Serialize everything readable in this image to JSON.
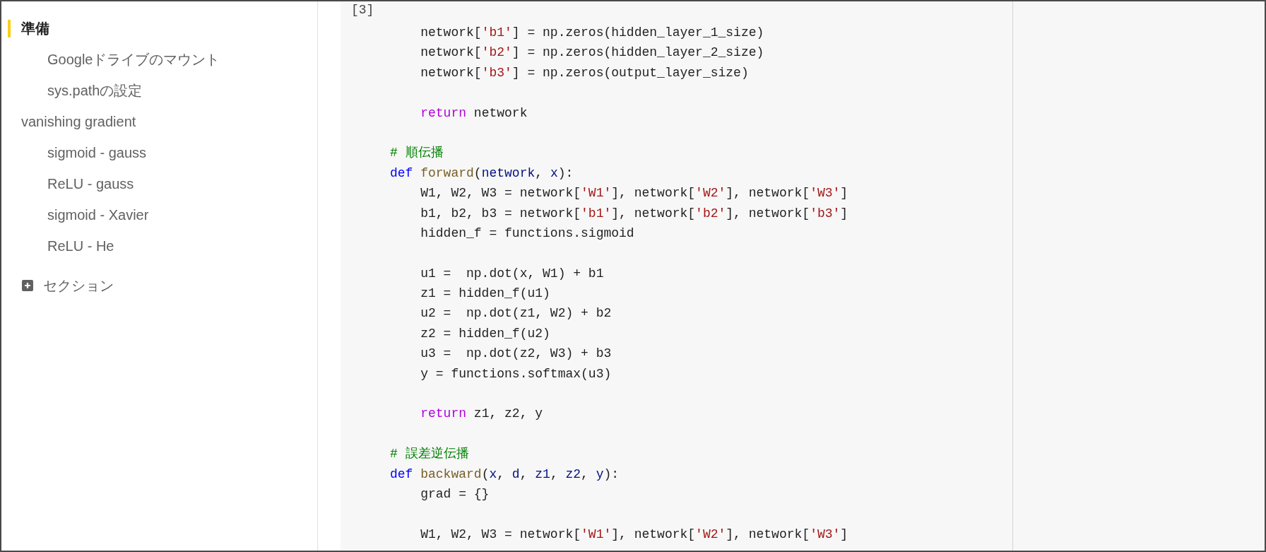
{
  "sidebar": {
    "toc": [
      {
        "label": "準備",
        "selected": true,
        "children": [
          {
            "label": "Googleドライブのマウント",
            "selected": false
          },
          {
            "label": "sys.pathの設定",
            "selected": false
          }
        ]
      },
      {
        "label": "vanishing gradient",
        "selected": false,
        "children": [
          {
            "label": "sigmoid - gauss",
            "selected": false
          },
          {
            "label": "ReLU - gauss",
            "selected": false
          },
          {
            "label": "sigmoid - Xavier",
            "selected": false
          },
          {
            "label": "ReLU - He",
            "selected": false
          }
        ]
      }
    ],
    "add_section": {
      "label": "セクション"
    }
  },
  "code_cell": {
    "execution_count": "[3]",
    "lines": [
      {
        "kind": "code",
        "tokens": [
          {
            "kind": "plain",
            "text": "    network["
          },
          {
            "kind": "string",
            "text": "'b1'"
          },
          {
            "kind": "plain",
            "text": "] = np.zeros(hidden_layer_1_size)"
          }
        ]
      },
      {
        "kind": "code",
        "tokens": [
          {
            "kind": "plain",
            "text": "    network["
          },
          {
            "kind": "string",
            "text": "'b2'"
          },
          {
            "kind": "plain",
            "text": "] = np.zeros(hidden_layer_2_size)"
          }
        ]
      },
      {
        "kind": "code",
        "tokens": [
          {
            "kind": "plain",
            "text": "    network["
          },
          {
            "kind": "string",
            "text": "'b3'"
          },
          {
            "kind": "plain",
            "text": "] = np.zeros(output_layer_size)"
          }
        ]
      },
      {
        "kind": "blank"
      },
      {
        "kind": "code",
        "tokens": [
          {
            "kind": "control",
            "text": "    return"
          },
          {
            "kind": "plain",
            "text": " network"
          }
        ]
      },
      {
        "kind": "blank"
      },
      {
        "kind": "code",
        "tokens": [
          {
            "kind": "comment",
            "text": "# 順伝播"
          }
        ]
      },
      {
        "kind": "code",
        "tokens": [
          {
            "kind": "keyword",
            "text": "def"
          },
          {
            "kind": "function",
            "text": " forward"
          },
          {
            "kind": "plain",
            "text": "("
          },
          {
            "kind": "param",
            "text": "network"
          },
          {
            "kind": "plain",
            "text": ", "
          },
          {
            "kind": "param",
            "text": "x"
          },
          {
            "kind": "plain",
            "text": "):"
          }
        ]
      },
      {
        "kind": "code",
        "tokens": [
          {
            "kind": "plain",
            "text": "    W1, W2, W3 = network["
          },
          {
            "kind": "string",
            "text": "'W1'"
          },
          {
            "kind": "plain",
            "text": "], network["
          },
          {
            "kind": "string",
            "text": "'W2'"
          },
          {
            "kind": "plain",
            "text": "], network["
          },
          {
            "kind": "string",
            "text": "'W3'"
          },
          {
            "kind": "plain",
            "text": "]"
          }
        ]
      },
      {
        "kind": "code",
        "tokens": [
          {
            "kind": "plain",
            "text": "    b1, b2, b3 = network["
          },
          {
            "kind": "string",
            "text": "'b1'"
          },
          {
            "kind": "plain",
            "text": "], network["
          },
          {
            "kind": "string",
            "text": "'b2'"
          },
          {
            "kind": "plain",
            "text": "], network["
          },
          {
            "kind": "string",
            "text": "'b3'"
          },
          {
            "kind": "plain",
            "text": "]"
          }
        ]
      },
      {
        "kind": "code",
        "tokens": [
          {
            "kind": "plain",
            "text": "    hidden_f = functions.sigmoid"
          }
        ]
      },
      {
        "kind": "blank"
      },
      {
        "kind": "code",
        "tokens": [
          {
            "kind": "plain",
            "text": "    u1 =  np.dot(x, W1) + b1"
          }
        ]
      },
      {
        "kind": "code",
        "tokens": [
          {
            "kind": "plain",
            "text": "    z1 = hidden_f(u1)"
          }
        ]
      },
      {
        "kind": "code",
        "tokens": [
          {
            "kind": "plain",
            "text": "    u2 =  np.dot(z1, W2) + b2"
          }
        ]
      },
      {
        "kind": "code",
        "tokens": [
          {
            "kind": "plain",
            "text": "    z2 = hidden_f(u2)"
          }
        ]
      },
      {
        "kind": "code",
        "tokens": [
          {
            "kind": "plain",
            "text": "    u3 =  np.dot(z2, W3) + b3"
          }
        ]
      },
      {
        "kind": "code",
        "tokens": [
          {
            "kind": "plain",
            "text": "    y = functions.softmax(u3)"
          }
        ]
      },
      {
        "kind": "blank"
      },
      {
        "kind": "code",
        "tokens": [
          {
            "kind": "control",
            "text": "    return"
          },
          {
            "kind": "plain",
            "text": " z1, z2, y"
          }
        ]
      },
      {
        "kind": "blank"
      },
      {
        "kind": "code",
        "tokens": [
          {
            "kind": "comment",
            "text": "# 誤差逆伝播"
          }
        ]
      },
      {
        "kind": "code",
        "tokens": [
          {
            "kind": "keyword",
            "text": "def"
          },
          {
            "kind": "function",
            "text": " backward"
          },
          {
            "kind": "plain",
            "text": "("
          },
          {
            "kind": "param",
            "text": "x"
          },
          {
            "kind": "plain",
            "text": ", "
          },
          {
            "kind": "param",
            "text": "d"
          },
          {
            "kind": "plain",
            "text": ", "
          },
          {
            "kind": "param",
            "text": "z1"
          },
          {
            "kind": "plain",
            "text": ", "
          },
          {
            "kind": "param",
            "text": "z2"
          },
          {
            "kind": "plain",
            "text": ", "
          },
          {
            "kind": "param",
            "text": "y"
          },
          {
            "kind": "plain",
            "text": "):"
          }
        ]
      },
      {
        "kind": "code",
        "tokens": [
          {
            "kind": "plain",
            "text": "    grad = {}"
          }
        ]
      },
      {
        "kind": "blank"
      },
      {
        "kind": "code",
        "tokens": [
          {
            "kind": "plain",
            "text": "    W1, W2, W3 = network["
          },
          {
            "kind": "string",
            "text": "'W1'"
          },
          {
            "kind": "plain",
            "text": "], network["
          },
          {
            "kind": "string",
            "text": "'W2'"
          },
          {
            "kind": "plain",
            "text": "], network["
          },
          {
            "kind": "string",
            "text": "'W3'"
          },
          {
            "kind": "plain",
            "text": "]"
          }
        ]
      }
    ]
  }
}
